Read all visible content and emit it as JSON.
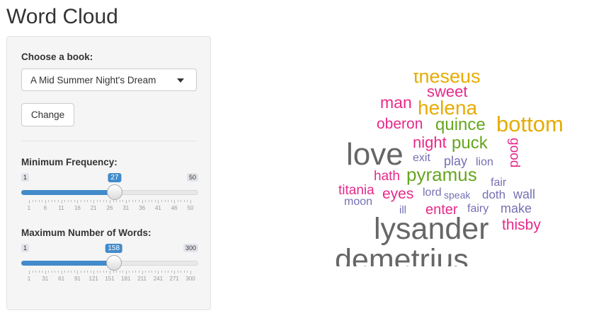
{
  "title": "Word Cloud",
  "controls": {
    "book_label": "Choose a book:",
    "book_selected": "A Mid Summer Night's Dream",
    "change_button": "Change",
    "min_freq": {
      "label": "Minimum Frequency:",
      "min": 1,
      "max": 50,
      "value": 27,
      "min_text": "1",
      "max_text": "50",
      "value_text": "27",
      "ticks": [
        "1",
        "6",
        "11",
        "16",
        "21",
        "26",
        "31",
        "36",
        "41",
        "46",
        "50"
      ]
    },
    "max_words": {
      "label": "Maximum Number of Words:",
      "min": 1,
      "max": 300,
      "value": 158,
      "min_text": "1",
      "max_text": "300",
      "value_text": "158",
      "ticks": [
        "1",
        "31",
        "61",
        "91",
        "121",
        "151",
        "181",
        "211",
        "241",
        "271",
        "300"
      ]
    }
  },
  "colors": {
    "accent": "#428bca",
    "gray": "#666666",
    "pink": "#e7298a",
    "green": "#66a61e",
    "gold": "#e6ab02",
    "purple": "#7570b3"
  },
  "cloud": {
    "words": [
      {
        "text": "theseus",
        "color": "gold"
      },
      {
        "text": "sweet",
        "color": "pink"
      },
      {
        "text": "man",
        "color": "pink"
      },
      {
        "text": "helena",
        "color": "gold"
      },
      {
        "text": "oberon",
        "color": "pink"
      },
      {
        "text": "quince",
        "color": "green"
      },
      {
        "text": "bottom",
        "color": "gold"
      },
      {
        "text": "love",
        "color": "gray"
      },
      {
        "text": "night",
        "color": "pink"
      },
      {
        "text": "puck",
        "color": "green"
      },
      {
        "text": "good",
        "color": "pink"
      },
      {
        "text": "exit",
        "color": "purple"
      },
      {
        "text": "play",
        "color": "purple"
      },
      {
        "text": "lion",
        "color": "purple"
      },
      {
        "text": "hath",
        "color": "pink"
      },
      {
        "text": "pyramus",
        "color": "green"
      },
      {
        "text": "fair",
        "color": "purple"
      },
      {
        "text": "titania",
        "color": "pink"
      },
      {
        "text": "eyes",
        "color": "pink"
      },
      {
        "text": "lord",
        "color": "purple"
      },
      {
        "text": "speak",
        "color": "purple"
      },
      {
        "text": "doth",
        "color": "purple"
      },
      {
        "text": "wall",
        "color": "purple"
      },
      {
        "text": "moon",
        "color": "purple"
      },
      {
        "text": "ill",
        "color": "purple"
      },
      {
        "text": "enter",
        "color": "pink"
      },
      {
        "text": "fairy",
        "color": "purple"
      },
      {
        "text": "make",
        "color": "purple"
      },
      {
        "text": "lysander",
        "color": "gray"
      },
      {
        "text": "thisby",
        "color": "pink"
      },
      {
        "text": "demetrius",
        "color": "gray"
      }
    ]
  }
}
